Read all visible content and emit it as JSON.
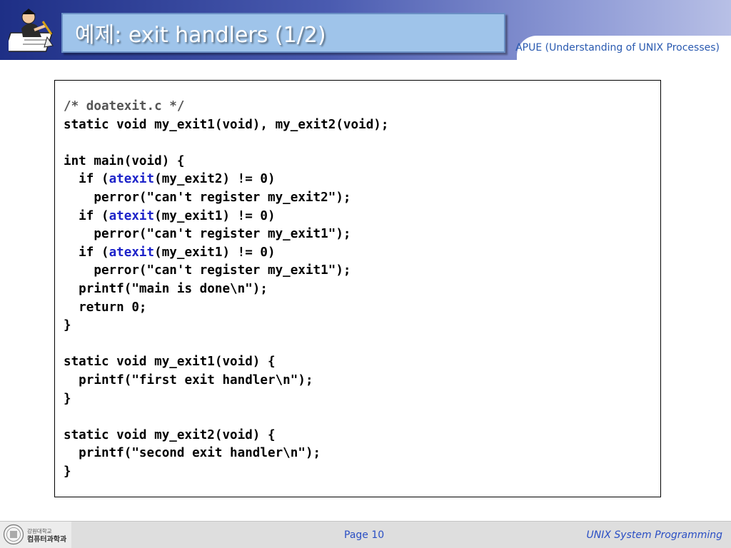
{
  "header": {
    "title": "예제: exit handlers (1/2)",
    "subtitle": "APUE (Understanding of UNIX Processes)",
    "logo_icon": "scholar-writing-icon"
  },
  "code": {
    "lines": [
      {
        "text": "/* doatexit.c */",
        "type": "comment"
      },
      {
        "text": "static void my_exit1(void), my_exit2(void);"
      },
      {
        "text": ""
      },
      {
        "text": "int main(void) {"
      },
      {
        "pre": "  if (",
        "fn": "atexit",
        "post": "(my_exit2) != 0)"
      },
      {
        "text": "    perror(\"can't register my_exit2\");"
      },
      {
        "pre": "  if (",
        "fn": "atexit",
        "post": "(my_exit1) != 0)"
      },
      {
        "text": "    perror(\"can't register my_exit1\");"
      },
      {
        "pre": "  if (",
        "fn": "atexit",
        "post": "(my_exit1) != 0)"
      },
      {
        "text": "    perror(\"can't register my_exit1\");"
      },
      {
        "text": "  printf(\"main is done\\n\");"
      },
      {
        "text": "  return 0;"
      },
      {
        "text": "}"
      },
      {
        "text": ""
      },
      {
        "text": "static void my_exit1(void) {"
      },
      {
        "text": "  printf(\"first exit handler\\n\");"
      },
      {
        "text": "}"
      },
      {
        "text": ""
      },
      {
        "text": "static void my_exit2(void) {"
      },
      {
        "text": "  printf(\"second exit handler\\n\");"
      },
      {
        "text": "}"
      }
    ]
  },
  "footer": {
    "university": "강원대학교",
    "department": "컴퓨터과학과",
    "page_label": "Page 10",
    "course": "UNIX System Programming",
    "seal_icon": "university-seal-icon"
  },
  "colors": {
    "header_dark": "#1e2f86",
    "title_box": "#9fc4ea",
    "highlight": "#1d23c9",
    "footer_text": "#2a4fc4"
  }
}
